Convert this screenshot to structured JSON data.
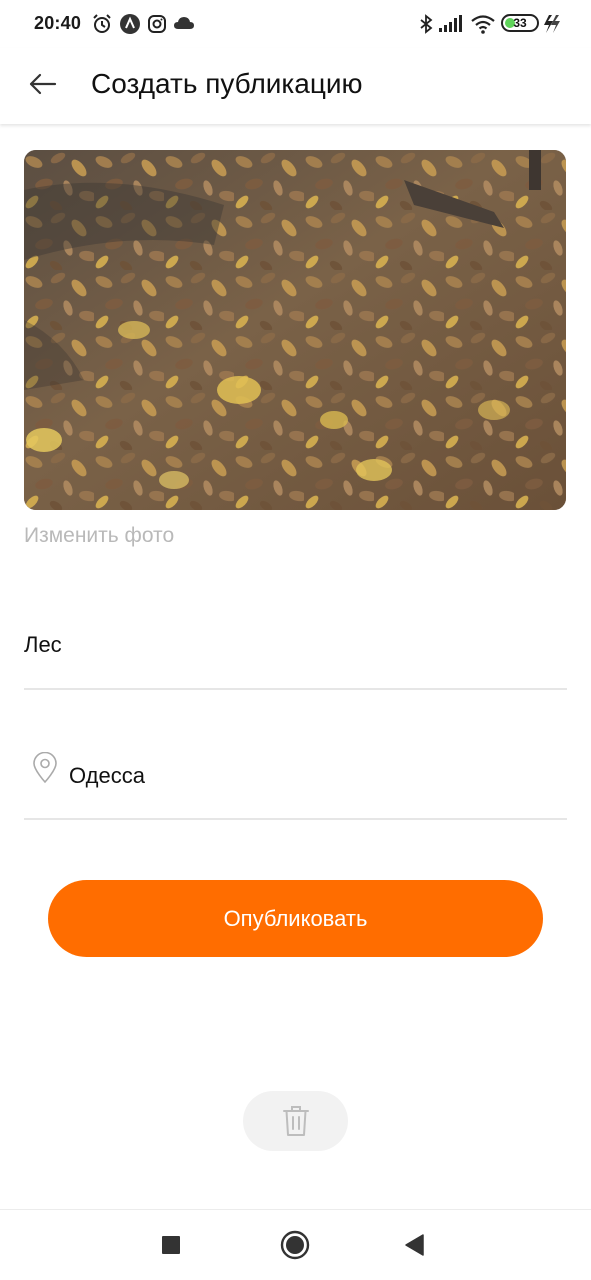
{
  "status_bar": {
    "time": "20:40",
    "left_icons": [
      "alarm-icon",
      "app-a-icon",
      "instagram-icon",
      "cloud-icon"
    ],
    "right_icons": [
      "bluetooth-icon",
      "signal-icon",
      "wifi-icon",
      "battery-icon",
      "charging-icon"
    ],
    "battery_level": "33",
    "battery_fraction": 0.33,
    "battery_color": "#5fd35a"
  },
  "app_bar": {
    "back_icon": "arrow-left-icon",
    "title": "Создать публикацию"
  },
  "photo": {
    "description_icon": "photo-preview",
    "change_label": "Изменить фото"
  },
  "form": {
    "title_value": "Лес",
    "location_icon": "location-pin-icon",
    "location_value": "Одесса"
  },
  "actions": {
    "publish_label": "Опубликовать",
    "publish_color": "#ff6d00",
    "delete_icon": "trash-icon"
  },
  "nav_bar": {
    "items": [
      "recents-square-icon",
      "home-circle-icon",
      "back-triangle-icon"
    ]
  }
}
